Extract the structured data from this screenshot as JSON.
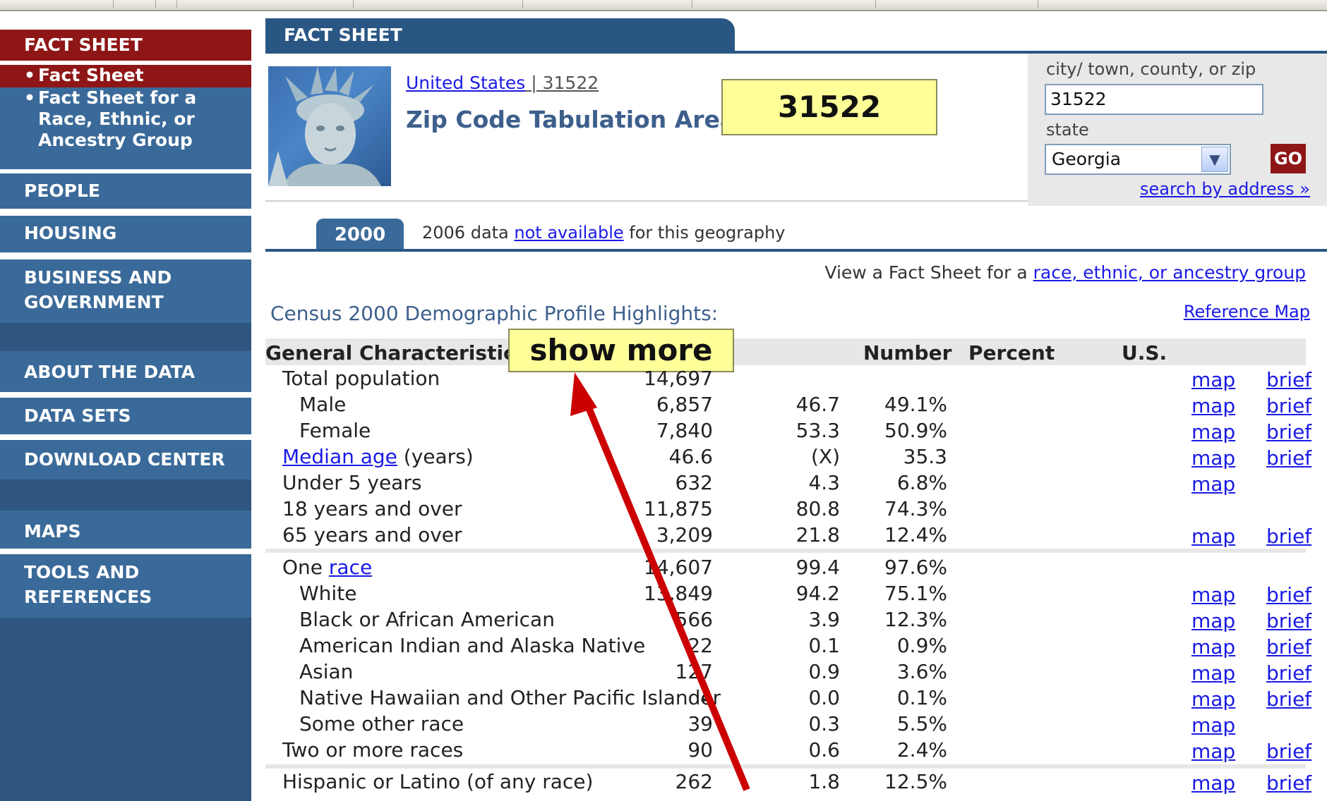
{
  "sidebar": {
    "fact_sheet_header": "FACT SHEET",
    "sub_items": [
      "Fact Sheet",
      "Fact Sheet for a",
      "Race, Ethnic, or",
      "Ancestry Group"
    ],
    "bullet": "•",
    "people": "PEOPLE",
    "housing": "HOUSING",
    "business_1": "BUSINESS AND",
    "business_2": "GOVERNMENT",
    "about": "ABOUT THE DATA",
    "datasets": "DATA SETS",
    "download": "DOWNLOAD CENTER",
    "maps": "MAPS",
    "tools_1": "TOOLS AND",
    "tools_2": "REFERENCES"
  },
  "header": {
    "tab_title": "FACT SHEET",
    "geo_link": "United States",
    "geo_sep": " | 31522",
    "geo_title": "Zip Code Tabulation Area",
    "callout": "31522"
  },
  "search": {
    "label_place": "city/ town, county, or zip",
    "place_value": "31522",
    "label_state": "state",
    "state_value": "Georgia",
    "go": "GO",
    "address_link": "search by address »"
  },
  "yearbar": {
    "year": "2000",
    "note_pre": "2006 data ",
    "note_link": "not available",
    "note_post": " for this geography"
  },
  "view_race": {
    "pre": "View a Fact Sheet for a ",
    "link": "race, ethnic, or ancestry group"
  },
  "census_title": "Census 2000 Demographic Profile Highlights:",
  "reference_map": "Reference Map",
  "table": {
    "head_label": "General Characteristics -",
    "head_number": "Number",
    "head_percent": "Percent",
    "head_us": "U.S.",
    "show_more": "show more",
    "rows": [
      {
        "label": "Total population",
        "number": "14,697",
        "percent": "",
        "us": "",
        "map": "map",
        "brief": "brief"
      },
      {
        "label": "Male",
        "number": "6,857",
        "percent": "46.7",
        "us": "49.1%",
        "map": "map",
        "brief": "brief"
      },
      {
        "label": "Female",
        "number": "7,840",
        "percent": "53.3",
        "us": "50.9%",
        "map": "map",
        "brief": "brief"
      },
      {
        "label_link": "Median age",
        "label_post": " (years)",
        "number": "46.6",
        "percent": "(X)",
        "us": "35.3",
        "map": "map",
        "brief": "brief"
      },
      {
        "label": "Under 5 years",
        "number": "632",
        "percent": "4.3",
        "us": "6.8%",
        "map": "map",
        "brief": ""
      },
      {
        "label": "18 years and over",
        "number": "11,875",
        "percent": "80.8",
        "us": "74.3%",
        "map": "",
        "brief": ""
      },
      {
        "label": "65 years and over",
        "number": "3,209",
        "percent": "21.8",
        "us": "12.4%",
        "map": "map",
        "brief": "brief"
      },
      {
        "label_pre": "One ",
        "label_link": "race",
        "number": "14,607",
        "percent": "99.4",
        "us": "97.6%",
        "map": "",
        "brief": ""
      },
      {
        "label": "White",
        "number": "13,849",
        "percent": "94.2",
        "us": "75.1%",
        "map": "map",
        "brief": "brief"
      },
      {
        "label": "Black or African American",
        "number": "566",
        "percent": "3.9",
        "us": "12.3%",
        "map": "map",
        "brief": "brief"
      },
      {
        "label": "American Indian and Alaska Native",
        "number": "22",
        "percent": "0.1",
        "us": "0.9%",
        "map": "map",
        "brief": "brief"
      },
      {
        "label": "Asian",
        "number": "127",
        "percent": "0.9",
        "us": "3.6%",
        "map": "map",
        "brief": "brief"
      },
      {
        "label": "Native Hawaiian and Other Pacific Islander",
        "number": "4",
        "percent": "0.0",
        "us": "0.1%",
        "map": "map",
        "brief": "brief"
      },
      {
        "label": "Some other race",
        "number": "39",
        "percent": "0.3",
        "us": "5.5%",
        "map": "map",
        "brief": ""
      },
      {
        "label": "Two or more races",
        "number": "90",
        "percent": "0.6",
        "us": "2.4%",
        "map": "map",
        "brief": "brief"
      },
      {
        "label": "Hispanic or Latino (of any race)",
        "number": "262",
        "percent": "1.8",
        "us": "12.5%",
        "map": "map",
        "brief": "brief"
      }
    ]
  },
  "colors": {
    "nav_blue": "#3a6a99",
    "nav_red": "#8e1616",
    "header_blue": "#2a5683",
    "callout_yellow": "#ffff99",
    "arrow_red": "#cc0000",
    "link_blue": "#1a1ae6"
  }
}
